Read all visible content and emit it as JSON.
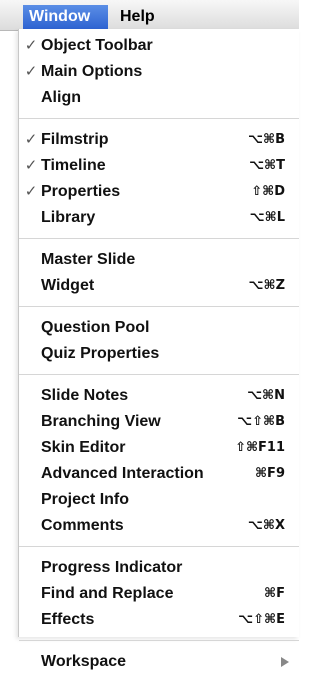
{
  "menubar": {
    "window_label": "Window",
    "help_label": "Help"
  },
  "menu": {
    "groups": [
      {
        "items": [
          {
            "label": "Object Toolbar",
            "checked": true,
            "checkmark": "✓",
            "shortcut": ""
          },
          {
            "label": "Main Options",
            "checked": true,
            "checkmark": "✓",
            "shortcut": ""
          },
          {
            "label": "Align",
            "checked": false,
            "checkmark": "",
            "shortcut": ""
          }
        ]
      },
      {
        "items": [
          {
            "label": "Filmstrip",
            "checked": true,
            "checkmark": "✓",
            "shortcut": "⌥⌘B"
          },
          {
            "label": "Timeline",
            "checked": true,
            "checkmark": "✓",
            "shortcut": "⌥⌘T"
          },
          {
            "label": "Properties",
            "checked": true,
            "checkmark": "✓",
            "shortcut": "⇧⌘D"
          },
          {
            "label": "Library",
            "checked": false,
            "checkmark": "",
            "shortcut": "⌥⌘L"
          }
        ]
      },
      {
        "items": [
          {
            "label": "Master Slide",
            "checked": false,
            "checkmark": "",
            "shortcut": ""
          },
          {
            "label": "Widget",
            "checked": false,
            "checkmark": "",
            "shortcut": "⌥⌘Z"
          }
        ]
      },
      {
        "items": [
          {
            "label": "Question Pool",
            "checked": false,
            "checkmark": "",
            "shortcut": ""
          },
          {
            "label": "Quiz Properties",
            "checked": false,
            "checkmark": "",
            "shortcut": ""
          }
        ]
      },
      {
        "items": [
          {
            "label": "Slide Notes",
            "checked": false,
            "checkmark": "",
            "shortcut": "⌥⌘N"
          },
          {
            "label": "Branching View",
            "checked": false,
            "checkmark": "",
            "shortcut": "⌥⇧⌘B"
          },
          {
            "label": "Skin Editor",
            "checked": false,
            "checkmark": "",
            "shortcut": "⇧⌘F11"
          },
          {
            "label": "Advanced Interaction",
            "checked": false,
            "checkmark": "",
            "shortcut": "⌘F9"
          },
          {
            "label": "Project Info",
            "checked": false,
            "checkmark": "",
            "shortcut": ""
          },
          {
            "label": "Comments",
            "checked": false,
            "checkmark": "",
            "shortcut": "⌥⌘X"
          }
        ]
      },
      {
        "items": [
          {
            "label": "Progress Indicator",
            "checked": false,
            "checkmark": "",
            "shortcut": ""
          },
          {
            "label": "Find and Replace",
            "checked": false,
            "checkmark": "",
            "shortcut": "⌘F"
          },
          {
            "label": "Effects",
            "checked": false,
            "checkmark": "",
            "shortcut": "⌥⇧⌘E"
          }
        ]
      },
      {
        "items": [
          {
            "label": "Workspace",
            "checked": false,
            "checkmark": "",
            "shortcut": "",
            "submenu": true
          }
        ]
      }
    ]
  },
  "colors": {
    "menubar_active_bg": "#3a6fd8",
    "menu_bg": "#ffffff",
    "separator": "#d6d6d6"
  }
}
